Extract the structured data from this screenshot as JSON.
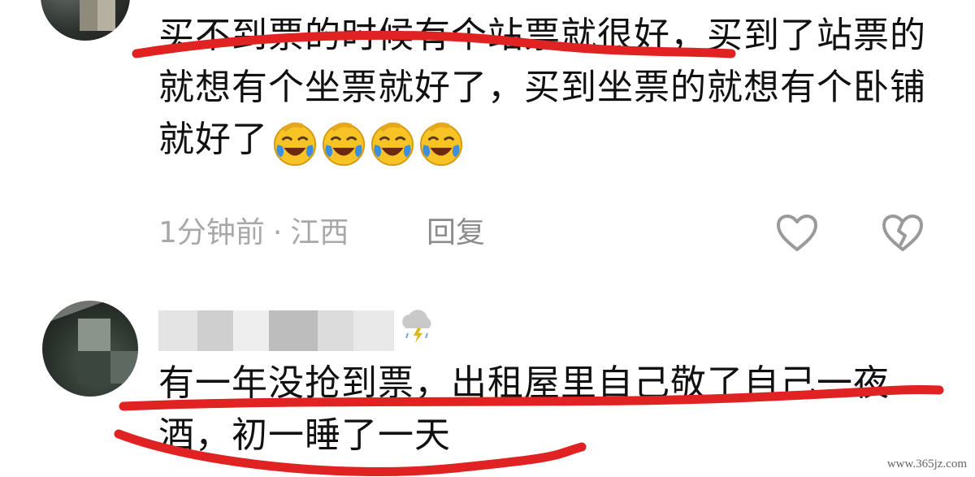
{
  "comments": [
    {
      "text": "买不到票的时候有个站票就很好，买到了站票的就想有个坐票就好了，买到坐票的就想有个卧铺就好了",
      "emojis": [
        "laugh-cry-emoji",
        "laugh-cry-emoji",
        "laugh-cry-emoji",
        "laugh-cry-emoji"
      ],
      "time": "1分钟前",
      "separator": "·",
      "location": "江西",
      "reply_label": "回复",
      "icons": {
        "like": "heart-outline-icon",
        "dislike": "broken-heart-icon"
      }
    },
    {
      "username_blurred": true,
      "user_badge_icon": "thunderstorm-icon",
      "text": "有一年没抢到票，出租屋里自己敬了自己一夜酒，初一睡了一天"
    }
  ],
  "watermark": "www.365jz.com",
  "colors": {
    "text": "#111111",
    "meta": "#a8a8a8",
    "underline": "#e02222",
    "emoji_face": "#f7c325",
    "emoji_tear": "#3c8fdc"
  }
}
